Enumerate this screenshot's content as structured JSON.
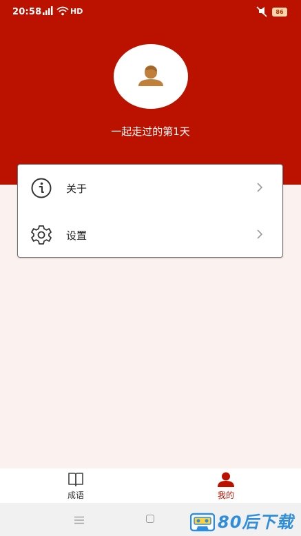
{
  "status_bar": {
    "time": "20:58",
    "network": "HD",
    "battery": "86"
  },
  "profile": {
    "days_text": "一起走过的第1天"
  },
  "menu": {
    "items": [
      {
        "label": "关于",
        "icon": "info-icon"
      },
      {
        "label": "设置",
        "icon": "gear-icon"
      }
    ]
  },
  "bottom_nav": {
    "items": [
      {
        "label": "成语",
        "icon": "book-icon",
        "active": false
      },
      {
        "label": "我的",
        "icon": "user-icon",
        "active": true
      }
    ]
  },
  "watermark": {
    "text": "80后下载"
  },
  "colors": {
    "primary": "#bb1200",
    "background": "#fbf1ef",
    "avatar_icon": "#c0803c",
    "inactive_nav": "#555555"
  }
}
